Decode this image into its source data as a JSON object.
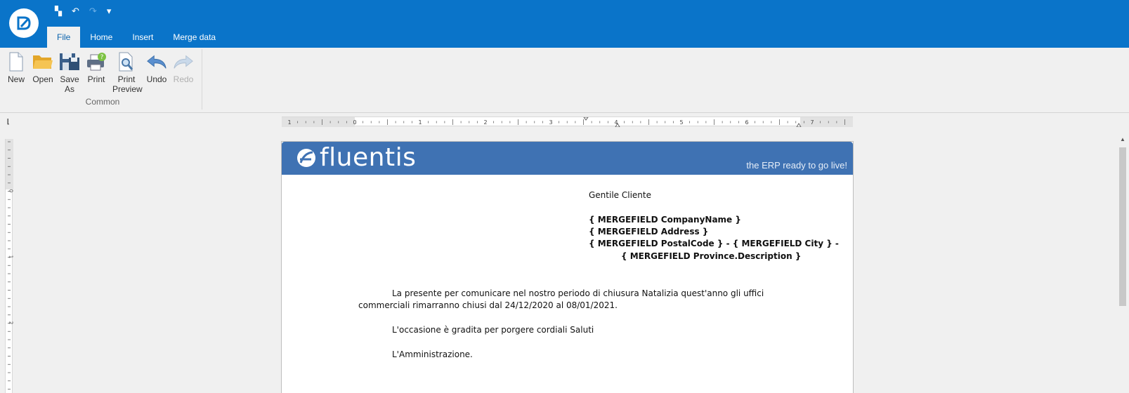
{
  "app": {
    "qat": {
      "save_glyph": "▚",
      "undo_glyph": "↶",
      "redo_glyph": "↷",
      "customize_glyph": "▾"
    },
    "tabs": [
      {
        "label": "File"
      },
      {
        "label": "Home"
      },
      {
        "label": "Insert"
      },
      {
        "label": "Merge data"
      }
    ]
  },
  "ribbon": {
    "group_label": "Common",
    "buttons": [
      {
        "label": "New",
        "icon": "new-document-icon"
      },
      {
        "label": "Open",
        "icon": "open-folder-icon"
      },
      {
        "label": "Save As",
        "icon": "save-as-icon"
      },
      {
        "label": "Print",
        "icon": "print-icon"
      },
      {
        "label": "Print Preview",
        "icon": "print-preview-icon"
      },
      {
        "label": "Undo",
        "icon": "undo-icon"
      },
      {
        "label": "Redo",
        "icon": "redo-icon",
        "disabled": true
      }
    ]
  },
  "ruler": {
    "h_numbers": [
      "1",
      "0",
      "1",
      "2",
      "3",
      "4",
      "5",
      "6",
      "7"
    ],
    "v_numbers": [
      "0",
      "1",
      "2"
    ]
  },
  "document": {
    "banner": {
      "brand": "fluentis",
      "tagline": "the ERP ready to go live!"
    },
    "greeting": "Gentile Cliente",
    "fields": [
      "{ MERGEFIELD CompanyName }",
      "{ MERGEFIELD Address }",
      "{ MERGEFIELD PostalCode } - { MERGEFIELD City } -",
      "{ MERGEFIELD Province.Description }"
    ],
    "body_line1": "La presente per comunicare nel nostro periodo di chiusura Natalizia quest'anno gli uffici",
    "body_line2": "commerciali rimarranno chiusi dal 24/12/2020 al 08/01/2021.",
    "closing": "L'occasione è gradita per porgere cordiali Saluti",
    "signature": "L'Amministrazione."
  },
  "colors": {
    "accent": "#0a74c9",
    "banner": "#3f72b3"
  }
}
